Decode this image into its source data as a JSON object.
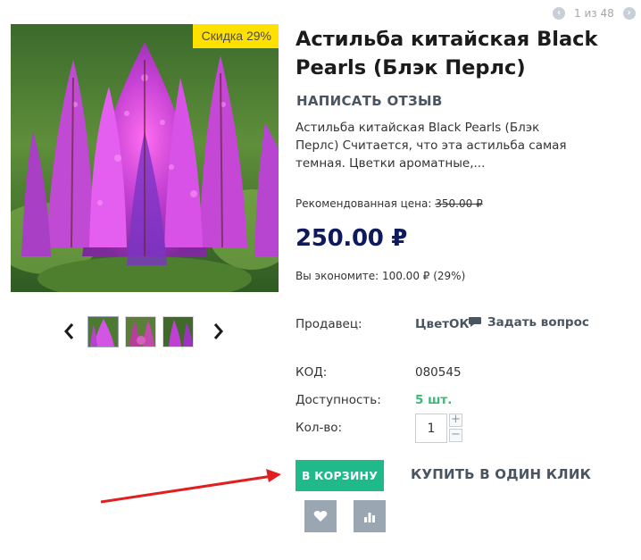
{
  "pager": {
    "text": "1 из 48",
    "prev_icon": "chevron-left-icon",
    "next_icon": "chevron-right-icon"
  },
  "product": {
    "discount_badge": "Скидка 29%",
    "title": "Астильба китайская Black Pearls (Блэк Перлс)",
    "review_link": "НАПИСАТЬ ОТЗЫВ",
    "description": "Астильба китайская Black Pearls (Блэк Перлс) Считается, что эта астильба самая темная. Цветки ароматные,...",
    "recommended_label": "Рекомендованная цена:",
    "recommended_price": "350.00 ₽",
    "price": "250.00 ₽",
    "savings": "Вы экономите: 100.00 ₽ (29%)"
  },
  "details": {
    "seller_label": "Продавец:",
    "seller_name": "ЦветОК",
    "ask_question": "Задать вопрос",
    "code_label": "КОД:",
    "code_value": "080545",
    "availability_label": "Доступность:",
    "availability_value": "5 шт.",
    "quantity_label": "Кол-во:",
    "quantity_value": "1"
  },
  "actions": {
    "add_to_cart": "В КОРЗИНУ",
    "one_click": "КУПИТЬ В ОДИН КЛИК",
    "wishlist_icon": "heart-icon",
    "compare_icon": "bar-chart-icon"
  },
  "colors": {
    "accent_green": "#1fb98a",
    "price_navy": "#0e1a5b",
    "discount_yellow": "#ffe100",
    "availability_green": "#3cb878",
    "icon_button_gray": "#9aa6b2",
    "annotation_red": "#e02020"
  }
}
